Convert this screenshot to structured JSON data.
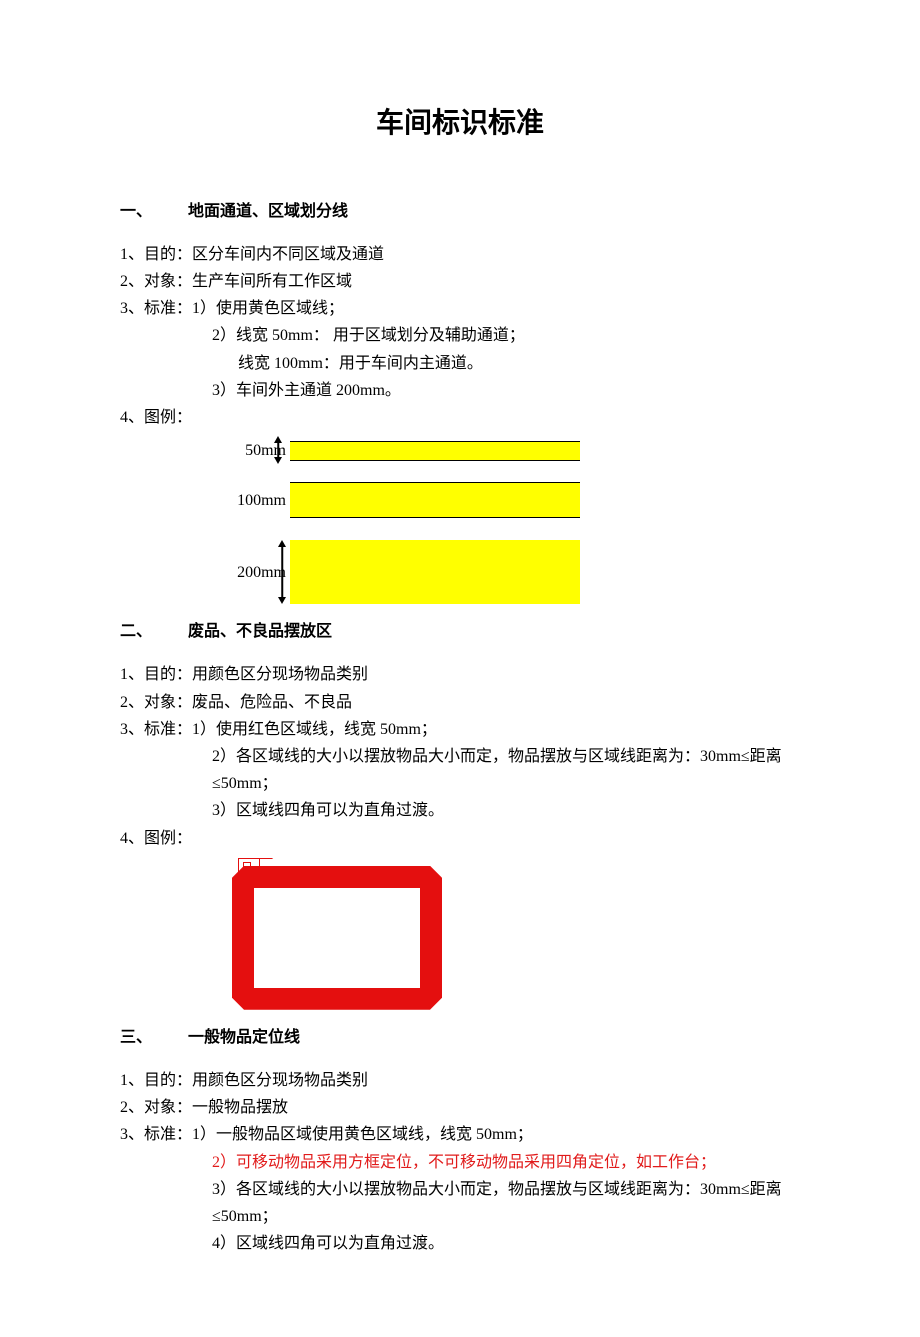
{
  "title": "车间标识标准",
  "sections": [
    {
      "num": "一、",
      "title": "地面通道、区域划分线",
      "items": [
        {
          "label": "1、目的：",
          "text": "区分车间内不同区域及通道"
        },
        {
          "label": "2、对象：",
          "text": "生产车间所有工作区域"
        },
        {
          "label": "3、标准：",
          "sub": [
            "1）使用黄色区域线；",
            "2）线宽 50mm：  用于区域划分及辅助通道；",
            "   线宽 100mm：用于车间内主通道。",
            "3）车间外主通道 200mm。"
          ]
        },
        {
          "label": "4、图例：",
          "text": ""
        }
      ],
      "diagram": {
        "labels": {
          "a": "50mm",
          "b": "100mm",
          "c": "200mm"
        }
      }
    },
    {
      "num": "二、",
      "title": "废品、不良品摆放区",
      "items": [
        {
          "label": "1、目的：",
          "text": "用颜色区分现场物品类别"
        },
        {
          "label": "2、对象：",
          "text": "废品、危险品、不良品"
        },
        {
          "label": "3、标准：",
          "sub": [
            "1）使用红色区域线，线宽 50mm；",
            "2）各区域线的大小以摆放物品大小而定，物品摆放与区域线距离为：30mm≤距离≤50mm；",
            "3）区域线四角可以为直角过渡。"
          ]
        },
        {
          "label": "4、图例：",
          "text": ""
        }
      ]
    },
    {
      "num": "三、",
      "title": "一般物品定位线",
      "items": [
        {
          "label": "1、目的：",
          "text": "用颜色区分现场物品类别"
        },
        {
          "label": "2、对象：",
          "text": "一般物品摆放"
        },
        {
          "label": "3、标准：",
          "sub": [
            "1）一般物品区域使用黄色区域线，线宽 50mm；",
            {
              "text": "2）可移动物品采用方框定位，不可移动物品采用四角定位，如工作台；",
              "red": true
            },
            "3）各区域线的大小以摆放物品大小而定，物品摆放与区域线距离为：30mm≤距离≤50mm；",
            "4）区域线四角可以为直角过渡。"
          ]
        }
      ]
    }
  ]
}
